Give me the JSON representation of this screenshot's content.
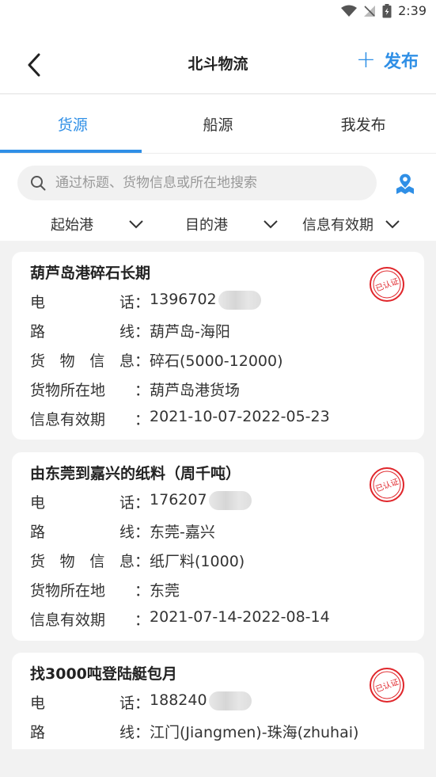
{
  "status": {
    "time": "2:39"
  },
  "header": {
    "title": "北斗物流",
    "publish_plus": "+",
    "publish_label": "发布"
  },
  "tabs": [
    {
      "label": "货源",
      "active": true
    },
    {
      "label": "船源",
      "active": false
    },
    {
      "label": "我发布",
      "active": false
    }
  ],
  "search": {
    "placeholder": "通过标题、货物信息或所在地搜索"
  },
  "filters": [
    {
      "label": "起始港"
    },
    {
      "label": "目的港"
    },
    {
      "label": "信息有效期"
    }
  ],
  "field_labels": {
    "phone_chars": [
      "电",
      "话"
    ],
    "route_chars": [
      "路",
      "线"
    ],
    "cargo_chars": [
      "货",
      "物",
      "信",
      "息"
    ],
    "location": "货物所在地",
    "validity": "信息有效期",
    "colon": "："
  },
  "stamp_text": "已认证",
  "colors": {
    "accent": "#2f8fe6",
    "stamp": "#e0262b"
  },
  "cards": [
    {
      "title": "葫芦岛港碎石长期",
      "phone": "1396702",
      "route": "葫芦岛-海阳",
      "cargo": "碎石(5000-12000)",
      "location": "葫芦岛港货场",
      "validity": "2021-10-07-2022-05-23"
    },
    {
      "title": "由东莞到嘉兴的纸料（周千吨）",
      "phone": "176207",
      "route": "东莞-嘉兴",
      "cargo": "纸厂料(1000)",
      "location": "东莞",
      "validity": "2021-07-14-2022-08-14"
    },
    {
      "title": "找3000吨登陆艇包月",
      "phone": "188240",
      "route": "江门(Jiangmen)-珠海(zhuhai)"
    }
  ]
}
